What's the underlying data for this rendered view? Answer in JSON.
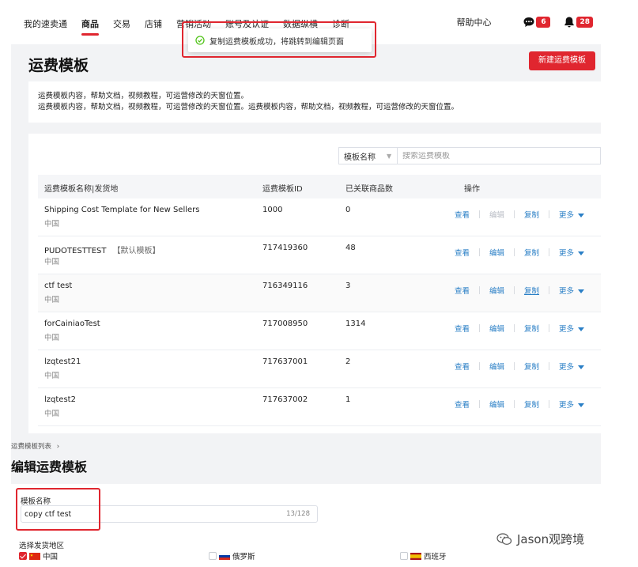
{
  "nav": {
    "items": [
      "我的速卖通",
      "商品",
      "交易",
      "店铺",
      "营销活动",
      "账号及认证",
      "数据纵横",
      "诊断"
    ],
    "active_index": 1
  },
  "header": {
    "help": "帮助中心",
    "message_count": "6",
    "notification_count": "28"
  },
  "toast": {
    "text": "复制运费模板成功，将跳转到编辑页面"
  },
  "page": {
    "title": "运费模板",
    "new_button": "新建运费模板"
  },
  "notice": {
    "line1": "运费模板内容，帮助文档，视频教程，可运营修改的天窗位置。",
    "line2": "运费模板内容，帮助文档，视频教程，可运营修改的天窗位置。运费模板内容，帮助文档，视频教程，可运营修改的天窗位置。"
  },
  "filter": {
    "select_value": "模板名称",
    "placeholder": "搜索运费模板"
  },
  "table": {
    "columns": [
      "运费模板名称|发货地",
      "运费模板ID",
      "已关联商品数",
      "操作"
    ],
    "rows": [
      {
        "name": "Shipping Cost Template for New Sellers",
        "tag": "",
        "location": "中国",
        "id": "1000",
        "count": "0",
        "edit_disabled": true
      },
      {
        "name": "PUDOTESTTEST",
        "tag": "【默认模板】",
        "location": "中国",
        "id": "717419360",
        "count": "48",
        "edit_disabled": false
      },
      {
        "name": "ctf test",
        "tag": "",
        "location": "中国",
        "id": "716349116",
        "count": "3",
        "edit_disabled": false
      },
      {
        "name": "forCainiaoTest",
        "tag": "",
        "location": "中国",
        "id": "717008950",
        "count": "1314",
        "edit_disabled": false
      },
      {
        "name": "lzqtest21",
        "tag": "",
        "location": "中国",
        "id": "717637001",
        "count": "2",
        "edit_disabled": false
      },
      {
        "name": "lzqtest2",
        "tag": "",
        "location": "中国",
        "id": "717637002",
        "count": "1",
        "edit_disabled": false
      }
    ],
    "actions": {
      "view": "查看",
      "edit": "编辑",
      "copy": "复制",
      "more": "更多"
    }
  },
  "edit": {
    "breadcrumb": "运费模板列表",
    "title": "编辑运费模板",
    "name_label": "模板名称",
    "name_value": "copy ctf test",
    "name_counter": "13/128",
    "region_label": "选择发货地区",
    "regions": [
      {
        "name": "中国",
        "checked": true
      },
      {
        "name": "俄罗斯",
        "checked": false
      },
      {
        "name": "西班牙",
        "checked": false
      }
    ]
  },
  "watermark": {
    "text": "Jason观跨境"
  },
  "colors": {
    "accent": "#e0262f",
    "link": "#2a7fc6",
    "success": "#52c41a",
    "page_bg": "#f2f3f5"
  }
}
